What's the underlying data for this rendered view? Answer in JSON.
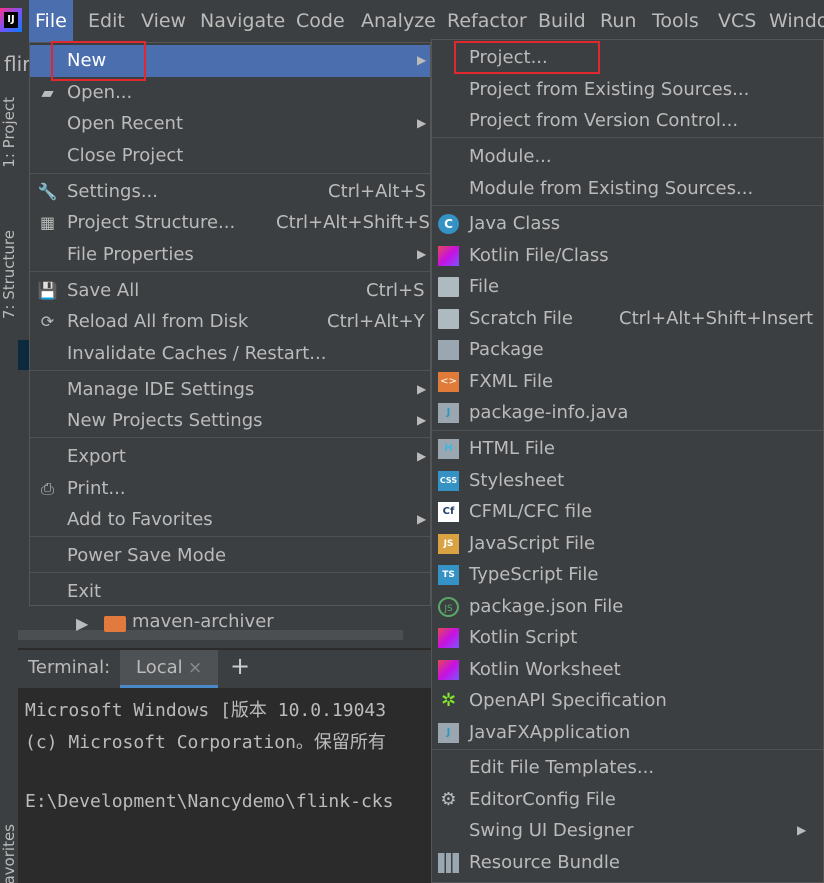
{
  "menubar": {
    "items": [
      "File",
      "Edit",
      "View",
      "Navigate",
      "Code",
      "Analyze",
      "Refactor",
      "Build",
      "Run",
      "Tools",
      "VCS",
      "Windo"
    ]
  },
  "toolbar": {
    "project_name": "flir"
  },
  "side_tabs": {
    "project": "1: Project",
    "structure": "7: Structure",
    "favorites": "avorites"
  },
  "file_menu": {
    "items": [
      {
        "label": "New",
        "shortcut": "",
        "submenu": true,
        "icon": "none"
      },
      {
        "label": "Open...",
        "shortcut": "",
        "submenu": false,
        "icon": "folder-open-icon"
      },
      {
        "label": "Open Recent",
        "shortcut": "",
        "submenu": true,
        "icon": "none"
      },
      {
        "label": "Close Project",
        "shortcut": "",
        "submenu": false,
        "icon": "none"
      },
      {
        "label": "Settings...",
        "shortcut": "Ctrl+Alt+S",
        "submenu": false,
        "icon": "wrench-icon"
      },
      {
        "label": "Project Structure...",
        "shortcut": "Ctrl+Alt+Shift+S",
        "submenu": false,
        "icon": "project-structure-icon"
      },
      {
        "label": "File Properties",
        "shortcut": "",
        "submenu": true,
        "icon": "none"
      },
      {
        "label": "Save All",
        "shortcut": "Ctrl+S",
        "submenu": false,
        "icon": "save-icon"
      },
      {
        "label": "Reload All from Disk",
        "shortcut": "Ctrl+Alt+Y",
        "submenu": false,
        "icon": "reload-icon"
      },
      {
        "label": "Invalidate Caches / Restart...",
        "shortcut": "",
        "submenu": false,
        "icon": "none"
      },
      {
        "label": "Manage IDE Settings",
        "shortcut": "",
        "submenu": true,
        "icon": "none"
      },
      {
        "label": "New Projects Settings",
        "shortcut": "",
        "submenu": true,
        "icon": "none"
      },
      {
        "label": "Export",
        "shortcut": "",
        "submenu": true,
        "icon": "none"
      },
      {
        "label": "Print...",
        "shortcut": "",
        "submenu": false,
        "icon": "printer-icon"
      },
      {
        "label": "Add to Favorites",
        "shortcut": "",
        "submenu": true,
        "icon": "none"
      },
      {
        "label": "Power Save Mode",
        "shortcut": "",
        "submenu": false,
        "icon": "none"
      },
      {
        "label": "Exit",
        "shortcut": "",
        "submenu": false,
        "icon": "none"
      }
    ]
  },
  "new_menu": {
    "items": [
      {
        "label": "Project...",
        "shortcut": "",
        "icon": "none"
      },
      {
        "label": "Project from Existing Sources...",
        "shortcut": "",
        "icon": "none"
      },
      {
        "label": "Project from Version Control...",
        "shortcut": "",
        "icon": "none"
      },
      {
        "label": "Module...",
        "shortcut": "",
        "icon": "none"
      },
      {
        "label": "Module from Existing Sources...",
        "shortcut": "",
        "icon": "none"
      },
      {
        "label": "Java Class",
        "shortcut": "",
        "icon": "java-class-icon"
      },
      {
        "label": "Kotlin File/Class",
        "shortcut": "",
        "icon": "kotlin-file-icon"
      },
      {
        "label": "File",
        "shortcut": "",
        "icon": "file-icon"
      },
      {
        "label": "Scratch File",
        "shortcut": "Ctrl+Alt+Shift+Insert",
        "icon": "scratch-file-icon"
      },
      {
        "label": "Package",
        "shortcut": "",
        "icon": "package-icon"
      },
      {
        "label": "FXML File",
        "shortcut": "",
        "icon": "fxml-file-icon"
      },
      {
        "label": "package-info.java",
        "shortcut": "",
        "icon": "package-info-icon"
      },
      {
        "label": "HTML File",
        "shortcut": "",
        "icon": "html-file-icon"
      },
      {
        "label": "Stylesheet",
        "shortcut": "",
        "icon": "css-file-icon"
      },
      {
        "label": "CFML/CFC file",
        "shortcut": "",
        "icon": "cfml-file-icon"
      },
      {
        "label": "JavaScript File",
        "shortcut": "",
        "icon": "javascript-file-icon"
      },
      {
        "label": "TypeScript File",
        "shortcut": "",
        "icon": "typescript-file-icon"
      },
      {
        "label": "package.json File",
        "shortcut": "",
        "icon": "nodejs-icon"
      },
      {
        "label": "Kotlin Script",
        "shortcut": "",
        "icon": "kotlin-script-icon"
      },
      {
        "label": "Kotlin Worksheet",
        "shortcut": "",
        "icon": "kotlin-worksheet-icon"
      },
      {
        "label": "OpenAPI Specification",
        "shortcut": "",
        "icon": "openapi-icon"
      },
      {
        "label": "JavaFXApplication",
        "shortcut": "",
        "icon": "javafx-icon"
      },
      {
        "label": "Edit File Templates...",
        "shortcut": "",
        "icon": "none"
      },
      {
        "label": "EditorConfig File",
        "shortcut": "",
        "icon": "gear-icon"
      },
      {
        "label": "Swing UI Designer",
        "shortcut": "",
        "icon": "none"
      },
      {
        "label": "Resource Bundle",
        "shortcut": "",
        "icon": "resource-bundle-icon"
      }
    ]
  },
  "project_tree": {
    "folder_label": "maven-archiver"
  },
  "terminal": {
    "title": "Terminal:",
    "tab_label": "Local",
    "close_glyph": "×",
    "add_glyph": "+",
    "lines": [
      "Microsoft Windows [版本 10.0.19043",
      "(c) Microsoft Corporation。保留所有",
      "",
      "E:\\Development\\Nancydemo\\flink-cks"
    ]
  },
  "colors": {
    "menu_bg": "#3c3f41",
    "selection": "#4b6eaf",
    "highlight_box": "#e0282e"
  }
}
